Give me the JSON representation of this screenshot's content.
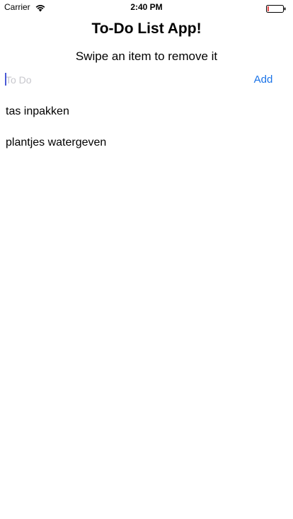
{
  "status_bar": {
    "carrier": "Carrier",
    "time": "2:40 PM",
    "wifi_icon": "wifi-icon",
    "battery_icon": "battery-icon",
    "battery_level": 0.08,
    "battery_color": "#e02020"
  },
  "header": {
    "title": "To-Do List App!",
    "subtitle": "Swipe an item to remove it"
  },
  "input": {
    "placeholder": "To Do",
    "value": ""
  },
  "add_button": {
    "label": "Add",
    "color": "#1a73e8"
  },
  "todos": [
    {
      "text": "tas inpakken"
    },
    {
      "text": "plantjes watergeven"
    }
  ]
}
